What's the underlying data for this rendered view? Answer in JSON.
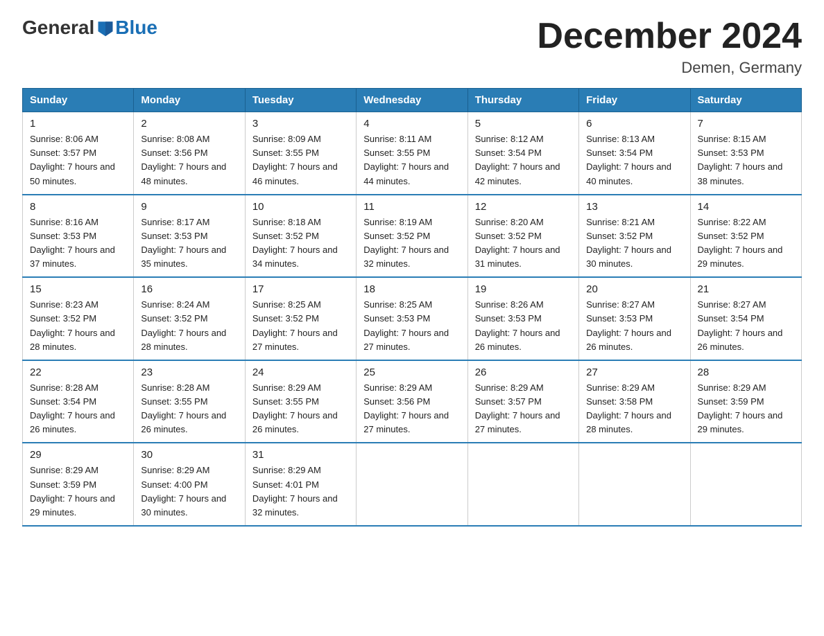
{
  "logo": {
    "general": "General",
    "blue": "Blue"
  },
  "title": "December 2024",
  "subtitle": "Demen, Germany",
  "days_of_week": [
    "Sunday",
    "Monday",
    "Tuesday",
    "Wednesday",
    "Thursday",
    "Friday",
    "Saturday"
  ],
  "weeks": [
    [
      {
        "day": 1,
        "sunrise": "8:06 AM",
        "sunset": "3:57 PM",
        "daylight": "7 hours and 50 minutes."
      },
      {
        "day": 2,
        "sunrise": "8:08 AM",
        "sunset": "3:56 PM",
        "daylight": "7 hours and 48 minutes."
      },
      {
        "day": 3,
        "sunrise": "8:09 AM",
        "sunset": "3:55 PM",
        "daylight": "7 hours and 46 minutes."
      },
      {
        "day": 4,
        "sunrise": "8:11 AM",
        "sunset": "3:55 PM",
        "daylight": "7 hours and 44 minutes."
      },
      {
        "day": 5,
        "sunrise": "8:12 AM",
        "sunset": "3:54 PM",
        "daylight": "7 hours and 42 minutes."
      },
      {
        "day": 6,
        "sunrise": "8:13 AM",
        "sunset": "3:54 PM",
        "daylight": "7 hours and 40 minutes."
      },
      {
        "day": 7,
        "sunrise": "8:15 AM",
        "sunset": "3:53 PM",
        "daylight": "7 hours and 38 minutes."
      }
    ],
    [
      {
        "day": 8,
        "sunrise": "8:16 AM",
        "sunset": "3:53 PM",
        "daylight": "7 hours and 37 minutes."
      },
      {
        "day": 9,
        "sunrise": "8:17 AM",
        "sunset": "3:53 PM",
        "daylight": "7 hours and 35 minutes."
      },
      {
        "day": 10,
        "sunrise": "8:18 AM",
        "sunset": "3:52 PM",
        "daylight": "7 hours and 34 minutes."
      },
      {
        "day": 11,
        "sunrise": "8:19 AM",
        "sunset": "3:52 PM",
        "daylight": "7 hours and 32 minutes."
      },
      {
        "day": 12,
        "sunrise": "8:20 AM",
        "sunset": "3:52 PM",
        "daylight": "7 hours and 31 minutes."
      },
      {
        "day": 13,
        "sunrise": "8:21 AM",
        "sunset": "3:52 PM",
        "daylight": "7 hours and 30 minutes."
      },
      {
        "day": 14,
        "sunrise": "8:22 AM",
        "sunset": "3:52 PM",
        "daylight": "7 hours and 29 minutes."
      }
    ],
    [
      {
        "day": 15,
        "sunrise": "8:23 AM",
        "sunset": "3:52 PM",
        "daylight": "7 hours and 28 minutes."
      },
      {
        "day": 16,
        "sunrise": "8:24 AM",
        "sunset": "3:52 PM",
        "daylight": "7 hours and 28 minutes."
      },
      {
        "day": 17,
        "sunrise": "8:25 AM",
        "sunset": "3:52 PM",
        "daylight": "7 hours and 27 minutes."
      },
      {
        "day": 18,
        "sunrise": "8:25 AM",
        "sunset": "3:53 PM",
        "daylight": "7 hours and 27 minutes."
      },
      {
        "day": 19,
        "sunrise": "8:26 AM",
        "sunset": "3:53 PM",
        "daylight": "7 hours and 26 minutes."
      },
      {
        "day": 20,
        "sunrise": "8:27 AM",
        "sunset": "3:53 PM",
        "daylight": "7 hours and 26 minutes."
      },
      {
        "day": 21,
        "sunrise": "8:27 AM",
        "sunset": "3:54 PM",
        "daylight": "7 hours and 26 minutes."
      }
    ],
    [
      {
        "day": 22,
        "sunrise": "8:28 AM",
        "sunset": "3:54 PM",
        "daylight": "7 hours and 26 minutes."
      },
      {
        "day": 23,
        "sunrise": "8:28 AM",
        "sunset": "3:55 PM",
        "daylight": "7 hours and 26 minutes."
      },
      {
        "day": 24,
        "sunrise": "8:29 AM",
        "sunset": "3:55 PM",
        "daylight": "7 hours and 26 minutes."
      },
      {
        "day": 25,
        "sunrise": "8:29 AM",
        "sunset": "3:56 PM",
        "daylight": "7 hours and 27 minutes."
      },
      {
        "day": 26,
        "sunrise": "8:29 AM",
        "sunset": "3:57 PM",
        "daylight": "7 hours and 27 minutes."
      },
      {
        "day": 27,
        "sunrise": "8:29 AM",
        "sunset": "3:58 PM",
        "daylight": "7 hours and 28 minutes."
      },
      {
        "day": 28,
        "sunrise": "8:29 AM",
        "sunset": "3:59 PM",
        "daylight": "7 hours and 29 minutes."
      }
    ],
    [
      {
        "day": 29,
        "sunrise": "8:29 AM",
        "sunset": "3:59 PM",
        "daylight": "7 hours and 29 minutes."
      },
      {
        "day": 30,
        "sunrise": "8:29 AM",
        "sunset": "4:00 PM",
        "daylight": "7 hours and 30 minutes."
      },
      {
        "day": 31,
        "sunrise": "8:29 AM",
        "sunset": "4:01 PM",
        "daylight": "7 hours and 32 minutes."
      },
      null,
      null,
      null,
      null
    ]
  ]
}
